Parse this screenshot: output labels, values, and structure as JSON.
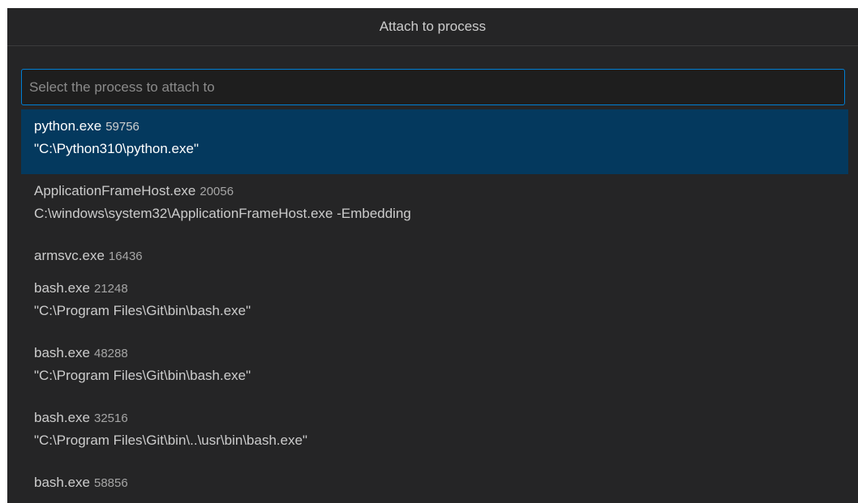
{
  "window": {
    "title": "Attach to process"
  },
  "search": {
    "placeholder": "Select the process to attach to",
    "value": ""
  },
  "processes": [
    {
      "name": "python.exe",
      "pid": "59756",
      "command": "\"C:\\Python310\\python.exe\"",
      "selected": true
    },
    {
      "name": "ApplicationFrameHost.exe",
      "pid": "20056",
      "command": "C:\\windows\\system32\\ApplicationFrameHost.exe -Embedding"
    },
    {
      "name": "armsvc.exe",
      "pid": "16436",
      "command": ""
    },
    {
      "name": "bash.exe",
      "pid": "21248",
      "command": "\"C:\\Program Files\\Git\\bin\\bash.exe\""
    },
    {
      "name": "bash.exe",
      "pid": "48288",
      "command": "\"C:\\Program Files\\Git\\bin\\bash.exe\""
    },
    {
      "name": "bash.exe",
      "pid": "32516",
      "command": "\"C:\\Program Files\\Git\\bin\\..\\usr\\bin\\bash.exe\""
    },
    {
      "name": "bash.exe",
      "pid": "58856",
      "command": ""
    }
  ],
  "colors": {
    "background": "#252526",
    "selection": "#04395e",
    "focus_border": "#007fd4"
  }
}
